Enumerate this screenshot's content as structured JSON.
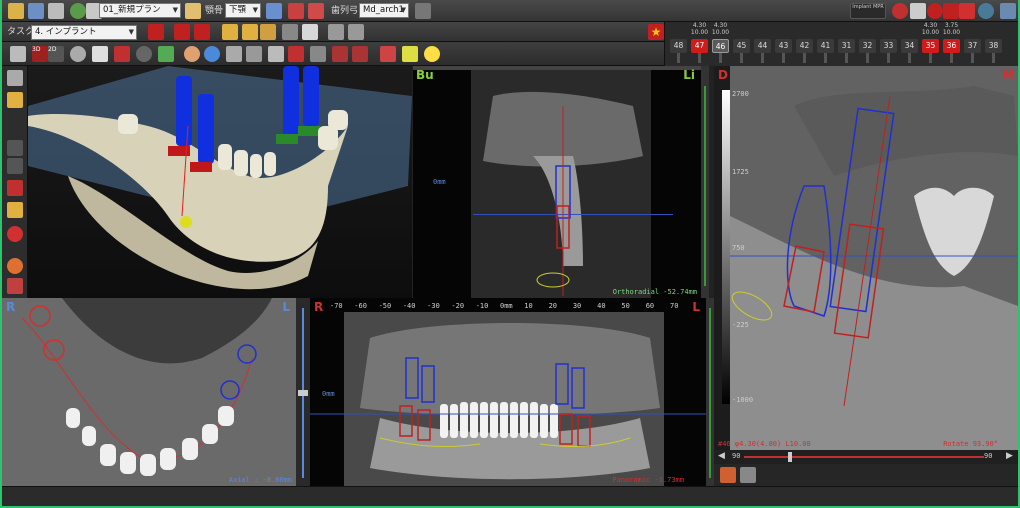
{
  "toolbar": {
    "plan_select": "01_新規プラン",
    "jaw_label": "顎骨",
    "jaw_select": "下顎",
    "arch_label": "歯列弓",
    "arch_select": "Md_arch1",
    "task_label": "タスク",
    "task_select": "4. インプラント",
    "brand": "Implant MPR",
    "btn_3d": "3D",
    "btn_2d": "2D"
  },
  "teeth": [
    {
      "id": "48",
      "diameter": "",
      "length": "",
      "state": "normal"
    },
    {
      "id": "47",
      "diameter": "4.30",
      "length": "10.00",
      "state": "active"
    },
    {
      "id": "46",
      "diameter": "4.30",
      "length": "10.00",
      "state": "selected"
    },
    {
      "id": "45",
      "diameter": "",
      "length": "",
      "state": "normal"
    },
    {
      "id": "44",
      "diameter": "",
      "length": "",
      "state": "normal"
    },
    {
      "id": "43",
      "diameter": "",
      "length": "",
      "state": "normal"
    },
    {
      "id": "42",
      "diameter": "",
      "length": "",
      "state": "normal"
    },
    {
      "id": "41",
      "diameter": "",
      "length": "",
      "state": "normal"
    },
    {
      "id": "31",
      "diameter": "",
      "length": "",
      "state": "normal"
    },
    {
      "id": "32",
      "diameter": "",
      "length": "",
      "state": "normal"
    },
    {
      "id": "33",
      "diameter": "",
      "length": "",
      "state": "normal"
    },
    {
      "id": "34",
      "diameter": "",
      "length": "",
      "state": "normal"
    },
    {
      "id": "35",
      "diameter": "4.30",
      "length": "10.00",
      "state": "active"
    },
    {
      "id": "36",
      "diameter": "3.75",
      "length": "10.00",
      "state": "active"
    },
    {
      "id": "37",
      "diameter": "",
      "length": "",
      "state": "normal"
    },
    {
      "id": "38",
      "diameter": "",
      "length": "",
      "state": "normal"
    }
  ],
  "views": {
    "ortho": {
      "left": "Bu",
      "right": "Li",
      "readout": "Orthoradial -52.74mm",
      "zero": "0mm"
    },
    "axial": {
      "left": "R",
      "right": "L",
      "readout": "Axial : -8.80mm"
    },
    "pano": {
      "left": "R",
      "right": "L",
      "readout": "Panoramic -1.73mm",
      "zero": "0mm",
      "ticks": [
        "-70",
        "-60",
        "-50",
        "-40",
        "-30",
        "-20",
        "-10",
        "0mm",
        "10",
        "20",
        "30",
        "40",
        "50",
        "60",
        "70"
      ]
    },
    "cross": {
      "left": "D",
      "right": "M",
      "readout_left": "#46 φ4.30(4.80) L10.00",
      "readout_right": "Rotate 93.90°",
      "scale": [
        "2700",
        "1725",
        "750",
        "-225",
        "-1000"
      ],
      "slider_min": "90",
      "slider_max": "90"
    }
  },
  "colors": {
    "accent_red": "#d11a1a",
    "frame_green": "#2ec46b",
    "implant_blue": "#1030e0"
  }
}
